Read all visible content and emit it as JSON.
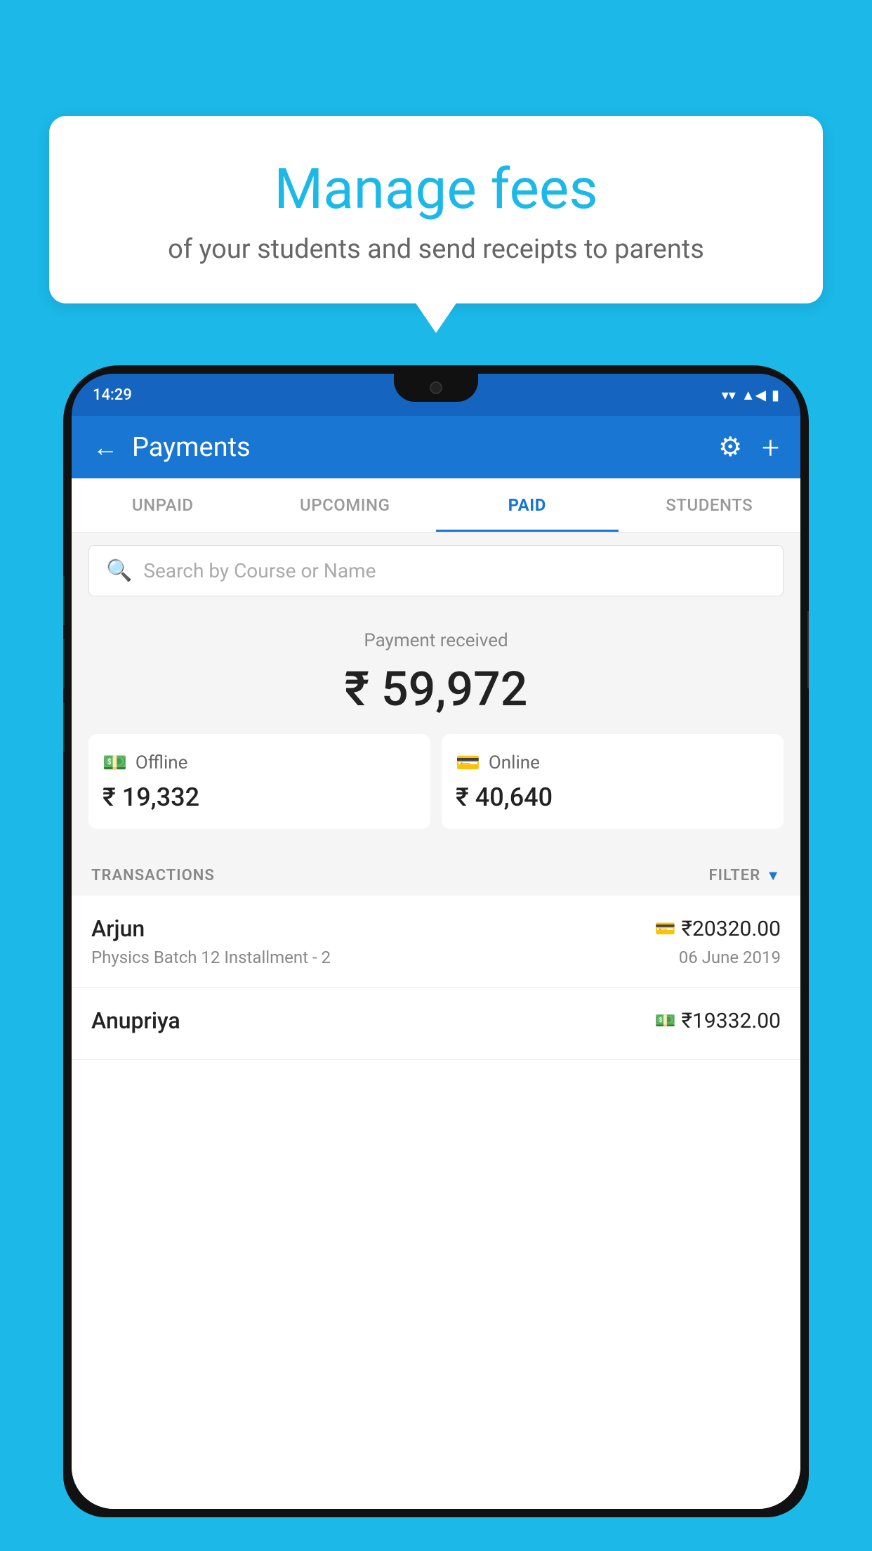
{
  "background_color": "#1BB8E8",
  "speech_bubble": {
    "title": "Manage fees",
    "subtitle": "of your students and send receipts to parents"
  },
  "status_bar": {
    "time": "14:29",
    "wifi": "▾",
    "signal": "▲",
    "battery": "▮"
  },
  "header": {
    "title": "Payments",
    "back_label": "←",
    "gear_label": "⚙",
    "plus_label": "+"
  },
  "tabs": [
    {
      "id": "unpaid",
      "label": "UNPAID",
      "active": false
    },
    {
      "id": "upcoming",
      "label": "UPCOMING",
      "active": false
    },
    {
      "id": "paid",
      "label": "PAID",
      "active": true
    },
    {
      "id": "students",
      "label": "STUDENTS",
      "active": false
    }
  ],
  "search": {
    "placeholder": "Search by Course or Name"
  },
  "payment_summary": {
    "label": "Payment received",
    "amount": "₹ 59,972",
    "offline_label": "Offline",
    "offline_amount": "₹ 19,332",
    "online_label": "Online",
    "online_amount": "₹ 40,640"
  },
  "transactions": {
    "header_label": "TRANSACTIONS",
    "filter_label": "FILTER",
    "items": [
      {
        "name": "Arjun",
        "course": "Physics Batch 12 Installment - 2",
        "amount": "₹20320.00",
        "date": "06 June 2019",
        "payment_type": "card"
      },
      {
        "name": "Anupriya",
        "course": "",
        "amount": "₹19332.00",
        "date": "",
        "payment_type": "cash"
      }
    ]
  }
}
